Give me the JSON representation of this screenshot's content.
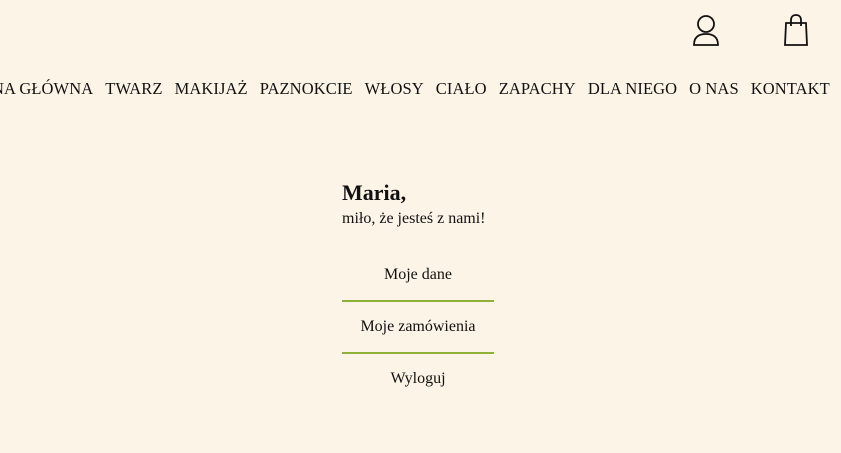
{
  "header": {
    "icons": {
      "account": "user-icon",
      "cart": "shopping-bag-icon"
    }
  },
  "nav": {
    "items": [
      {
        "label": "NA GŁÓWNA"
      },
      {
        "label": "TWARZ"
      },
      {
        "label": "MAKIJAŻ"
      },
      {
        "label": "PAZNOKCIE"
      },
      {
        "label": "WŁOSY"
      },
      {
        "label": "CIAŁO"
      },
      {
        "label": "ZAPACHY"
      },
      {
        "label": "DLA NIEGO"
      },
      {
        "label": "O NAS"
      },
      {
        "label": "KONTAKT"
      }
    ]
  },
  "account": {
    "name": "Maria,",
    "welcome": "miło, że jesteś z nami!",
    "menu": [
      {
        "label": "Moje dane"
      },
      {
        "label": "Moje zamówienia"
      },
      {
        "label": "Wyloguj"
      }
    ]
  },
  "colors": {
    "background": "#fdf4e8",
    "accent_divider": "#8fb13a",
    "text": "#111111"
  }
}
